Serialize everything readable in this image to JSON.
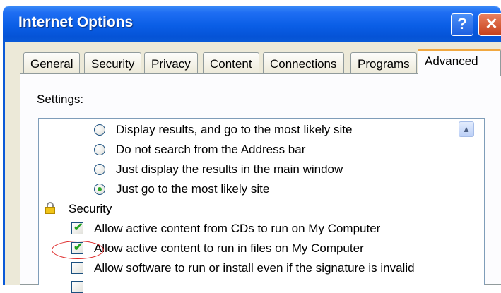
{
  "window": {
    "title": "Internet Options",
    "help_glyph": "?",
    "close_glyph": "✕"
  },
  "tabs": [
    {
      "label": "General"
    },
    {
      "label": "Security"
    },
    {
      "label": "Privacy"
    },
    {
      "label": "Content"
    },
    {
      "label": "Connections"
    },
    {
      "label": "Programs"
    },
    {
      "label": "Advanced",
      "selected": true
    }
  ],
  "settings": {
    "label": "Settings:",
    "scroll_up_glyph": "▲",
    "search_options": [
      {
        "label": "Display results, and go to the most likely site",
        "selected": false
      },
      {
        "label": "Do not search from the Address bar",
        "selected": false
      },
      {
        "label": "Just display the results in the main window",
        "selected": false
      },
      {
        "label": "Just go to the most likely site",
        "selected": true
      }
    ],
    "security_group": {
      "label": "Security",
      "icon": "lock-icon",
      "items": [
        {
          "label": "Allow active content from CDs to run on My Computer",
          "checked": true
        },
        {
          "label": "Allow active content to run in files on My Computer",
          "checked": true
        },
        {
          "label": "Allow software to run or install even if the signature is invalid",
          "checked": false
        }
      ]
    },
    "check_glyph": "✔"
  },
  "colors": {
    "titlebar": "#0a5ee6",
    "active_tab_accent": "#f1a840",
    "annotation": "#dd2222"
  }
}
